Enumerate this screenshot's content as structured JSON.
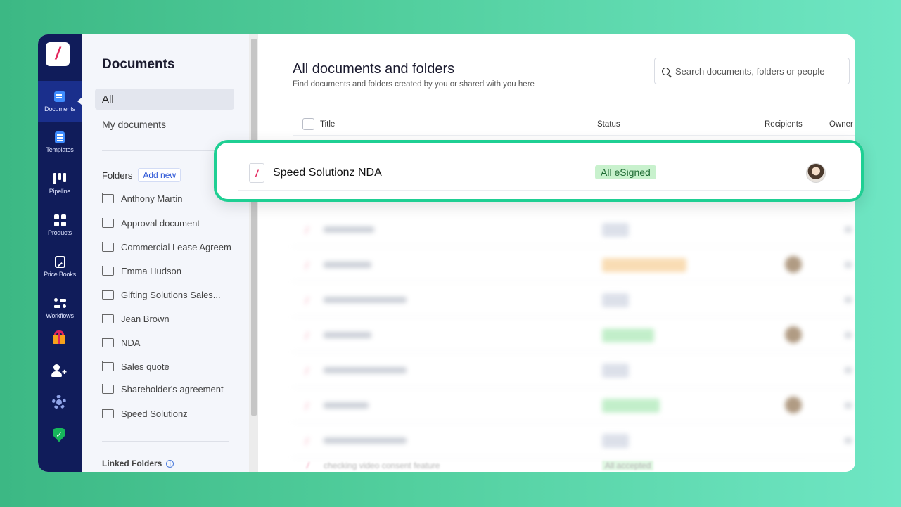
{
  "app": {
    "logo_glyph": "/",
    "accent_color": "#e3245b",
    "rail_color": "#101c5a"
  },
  "rail": {
    "items": [
      {
        "label": "Documents",
        "icon": "documents-icon",
        "active": true
      },
      {
        "label": "Templates",
        "icon": "templates-icon"
      },
      {
        "label": "Pipeline",
        "icon": "pipeline-icon"
      },
      {
        "label": "Products",
        "icon": "products-icon"
      },
      {
        "label": "Price Books",
        "icon": "price-books-icon"
      },
      {
        "label": "Workflows",
        "icon": "workflows-icon"
      }
    ],
    "extra_icons": [
      "gift-icon",
      "add-user-icon",
      "settings-gear-icon",
      "security-shield-icon"
    ]
  },
  "panel": {
    "title": "Documents",
    "nav_all": "All",
    "nav_mine": "My documents",
    "folders_label": "Folders",
    "add_new": "Add new",
    "folders": [
      "Anthony Martin",
      "Approval document",
      "Commercial Lease Agreem",
      "Emma Hudson",
      "Gifting Solutions Sales...",
      "Jean Brown",
      "NDA",
      "Sales quote",
      "Shareholder's agreement",
      "Speed Solutionz"
    ],
    "linked_folders": "Linked Folders"
  },
  "main": {
    "title": "All documents and folders",
    "subtitle": "Find documents and folders created by you or shared with you here",
    "search_placeholder": "Search documents, folders or people",
    "columns": {
      "title": "Title",
      "status": "Status",
      "recipients": "Recipients",
      "owner": "Owner"
    },
    "highlighted_row": {
      "title": "Speed Solutionz NDA",
      "status": "All eSigned",
      "status_color": "#c8f1cd"
    },
    "last_row": {
      "title": "checking video consent feature",
      "status": "All accepted"
    }
  }
}
